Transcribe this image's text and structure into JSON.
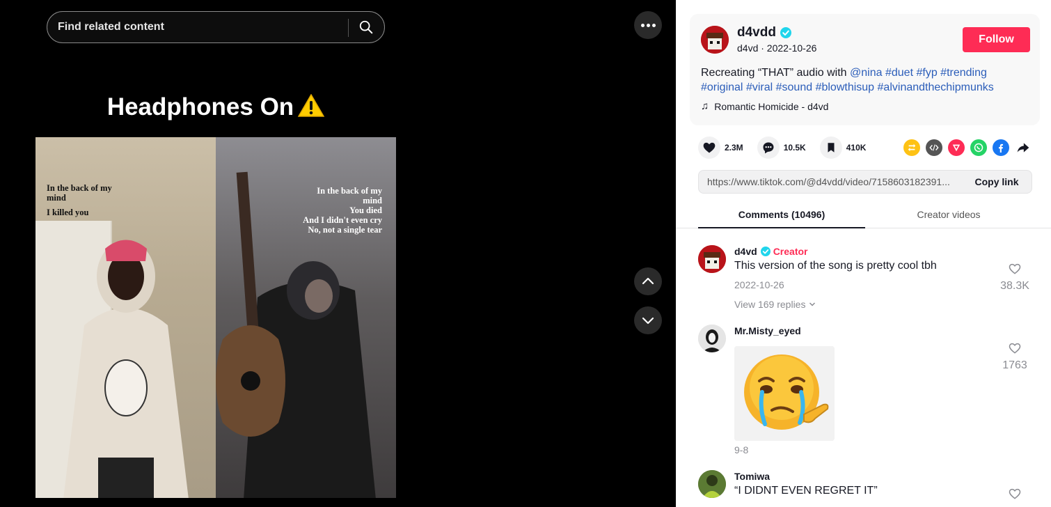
{
  "search": {
    "placeholder": "Find related content"
  },
  "video": {
    "caption": "Headphones On",
    "lyrics_left": [
      "In the back of my",
      "mind",
      "I killed you"
    ],
    "lyrics_right": [
      "In the back of my",
      "mind",
      "You died",
      "And I didn't even cry",
      "No, not a single tear"
    ]
  },
  "post": {
    "author_display": "d4vdd",
    "author_sub": "d4vd · 2022-10-26",
    "follow_label": "Follow",
    "desc_prefix": "Recreating “THAT” audio with",
    "mention": "@nina",
    "hashtags": [
      "#duet",
      "#fyp",
      "#trending",
      "#original",
      "#viral",
      "#sound",
      "#blowthisup",
      "#alvinandthechipmunks"
    ],
    "music": "Romantic Homicide - d4vd"
  },
  "stats": {
    "likes": "2.3M",
    "comments": "10.5K",
    "saves": "410K"
  },
  "share": {
    "repost_color": "#fec214",
    "embed_color": "#555555",
    "send_color": "#fe2c55",
    "whatsapp_color": "#25d366",
    "facebook_color": "#1877f2"
  },
  "link": {
    "url": "https://www.tiktok.com/@d4vdd/video/7158603182391...",
    "copy_label": "Copy link"
  },
  "tabs": {
    "comments": "Comments (10496)",
    "creator_videos": "Creator videos"
  },
  "comments": [
    {
      "user": "d4vd",
      "creator_label": "Creator",
      "text": "This version of the song is pretty cool tbh",
      "date": "2022-10-26",
      "replies": "View 169 replies",
      "likes": "38.3K"
    },
    {
      "user": "Mr.Misty_eyed",
      "date": "9-8",
      "likes": "1763"
    },
    {
      "user": "Tomiwa",
      "text": "“I DIDNT EVEN REGRET IT”"
    }
  ],
  "colors": {
    "accent": "#fe2c55",
    "verified": "#20d5ec",
    "hashtag": "#2b5db9"
  }
}
